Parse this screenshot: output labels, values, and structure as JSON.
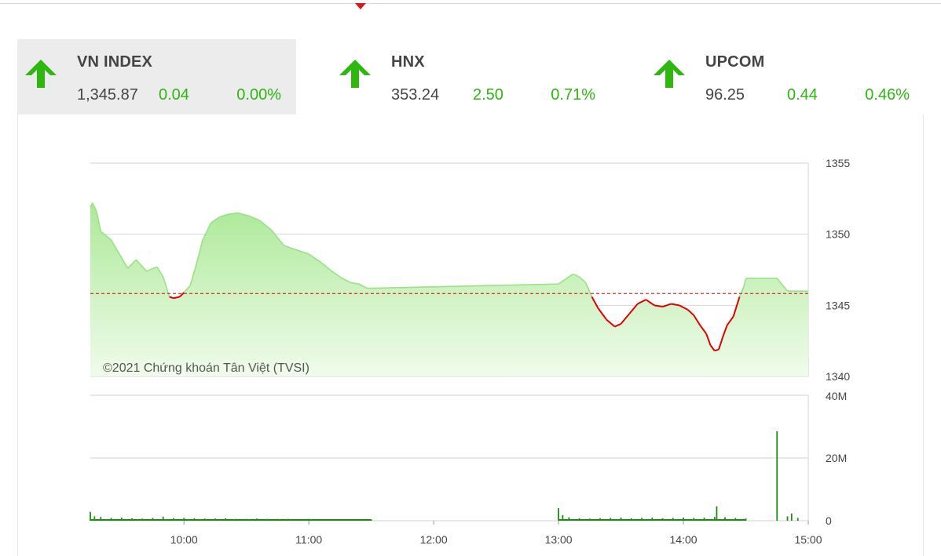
{
  "tabs": [
    {
      "name": "VN INDEX",
      "value": "1,345.87",
      "change": "0.04",
      "percent": "0.00%",
      "active": true,
      "trend": "up",
      "trend_icon": "arrow-up-icon"
    },
    {
      "name": "HNX",
      "value": "353.24",
      "change": "2.50",
      "percent": "0.71%",
      "active": false,
      "trend": "up",
      "trend_icon": "arrow-up-icon"
    },
    {
      "name": "UPCOM",
      "value": "96.25",
      "change": "0.44",
      "percent": "0.46%",
      "active": false,
      "trend": "up",
      "trend_icon": "arrow-up-icon"
    }
  ],
  "colors": {
    "up": "#2db70f",
    "down": "#e10000",
    "reference_line": "#e10000",
    "price_area_line": "#9be087",
    "volume_bar": "#1e8b14",
    "grid": "#d6d6d6"
  },
  "chart_data": [
    {
      "type": "area",
      "watermark": "©2021 Chứng khoán Tân Việt (TVSI)",
      "x_ticks": [
        "10:00",
        "11:00",
        "12:00",
        "13:00",
        "14:00",
        "15:00"
      ],
      "xlim": [
        "09:15",
        "15:00"
      ],
      "y_ticks": [
        "1355",
        "1350",
        "1345",
        "1340"
      ],
      "ylim": [
        1340,
        1355
      ],
      "grid": true,
      "y_axis_side": "right",
      "reference_value": 1345.83,
      "series": [
        {
          "x": [
            "09:15",
            "09:16",
            "09:18",
            "09:20",
            "09:25",
            "09:29",
            "09:33",
            "09:37",
            "09:42",
            "09:47",
            "09:50",
            "09:53",
            "09:55",
            "09:58",
            "10:00",
            "10:03",
            "10:06",
            "10:09",
            "10:13",
            "10:17",
            "10:21",
            "10:26",
            "10:31",
            "10:36",
            "10:42",
            "10:48",
            "10:54",
            "11:00",
            "11:06",
            "11:11",
            "11:16",
            "11:20",
            "11:24",
            "11:28",
            "11:30",
            "13:00",
            "13:03",
            "13:07",
            "13:10",
            "13:13",
            "13:16",
            "13:19",
            "13:23",
            "13:27",
            "13:30",
            "13:34",
            "13:38",
            "13:42",
            "13:46",
            "13:50",
            "13:54",
            "13:58",
            "14:02",
            "14:05",
            "14:08",
            "14:11",
            "14:13",
            "14:15",
            "14:17",
            "14:19",
            "14:21",
            "14:24",
            "14:27",
            "14:29",
            "14:30",
            "14:45",
            "14:50",
            "15:00"
          ],
          "y": [
            1351.9,
            1352.2,
            1351.6,
            1350.2,
            1349.6,
            1348.6,
            1347.6,
            1348.2,
            1347.4,
            1347.7,
            1347.0,
            1345.6,
            1345.5,
            1345.6,
            1345.9,
            1346.4,
            1347.9,
            1349.6,
            1350.8,
            1351.2,
            1351.4,
            1351.5,
            1351.3,
            1351.0,
            1350.3,
            1349.2,
            1348.9,
            1348.6,
            1348.0,
            1347.4,
            1346.9,
            1346.6,
            1346.5,
            1346.2,
            1346.2,
            1346.5,
            1346.8,
            1347.2,
            1347.0,
            1346.6,
            1345.6,
            1344.8,
            1344.0,
            1343.5,
            1343.7,
            1344.4,
            1345.1,
            1345.4,
            1345.0,
            1344.9,
            1345.1,
            1345.0,
            1344.7,
            1344.3,
            1343.6,
            1343.0,
            1342.2,
            1341.8,
            1341.9,
            1342.8,
            1343.6,
            1344.2,
            1345.6,
            1346.3,
            1346.9,
            1346.9,
            1346.0,
            1346.0
          ]
        }
      ]
    },
    {
      "type": "bar",
      "x_ticks": [
        "10:00",
        "11:00",
        "12:00",
        "13:00",
        "14:00",
        "15:00"
      ],
      "y_ticks": [
        "40M",
        "20M",
        "0"
      ],
      "ylim": [
        0,
        40000000
      ],
      "grid": true,
      "y_axis_side": "right",
      "series": [
        {
          "x": [
            "09:15",
            "09:17",
            "09:20",
            "09:25",
            "09:30",
            "09:35",
            "09:40",
            "09:45",
            "09:50",
            "09:55",
            "10:00",
            "10:05",
            "10:10",
            "10:15",
            "10:20",
            "10:25",
            "10:30",
            "10:35",
            "10:40",
            "10:45",
            "10:50",
            "10:55",
            "11:00",
            "11:05",
            "11:10",
            "11:15",
            "11:20",
            "11:25",
            "11:30",
            "13:00",
            "13:02",
            "13:05",
            "13:10",
            "13:15",
            "13:20",
            "13:25",
            "13:30",
            "13:35",
            "13:40",
            "13:45",
            "13:50",
            "13:55",
            "14:00",
            "14:05",
            "14:10",
            "14:15",
            "14:16",
            "14:20",
            "14:25",
            "14:30",
            "14:45",
            "14:50",
            "14:52",
            "14:55"
          ],
          "values": [
            2800000,
            1400000,
            1200000,
            900000,
            1000000,
            800000,
            700000,
            900000,
            1300000,
            800000,
            900000,
            800000,
            700000,
            700000,
            800000,
            600000,
            600000,
            700000,
            600000,
            600000,
            600000,
            500000,
            600000,
            500000,
            500000,
            500000,
            500000,
            400000,
            400000,
            4000000,
            1800000,
            1100000,
            800000,
            700000,
            800000,
            900000,
            1000000,
            800000,
            900000,
            1000000,
            800000,
            900000,
            1000000,
            900000,
            1000000,
            1200000,
            4600000,
            1100000,
            900000,
            700000,
            28500000,
            1400000,
            2300000,
            900000
          ]
        }
      ]
    }
  ]
}
